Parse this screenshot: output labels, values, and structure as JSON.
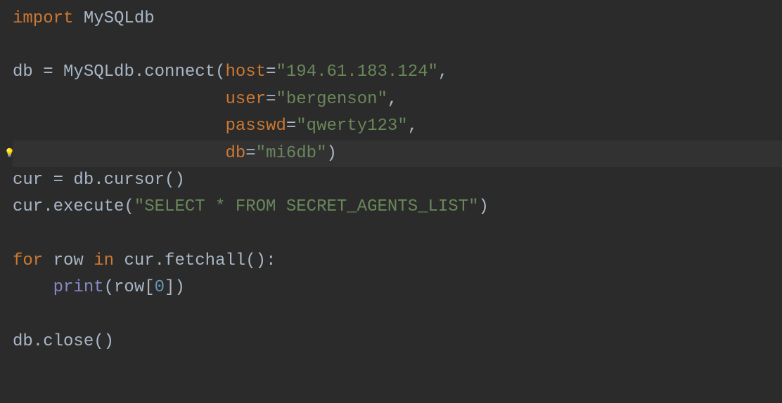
{
  "code": {
    "line1": {
      "import_kw": "import",
      "module": " MySQLdb"
    },
    "line2": {
      "text": ""
    },
    "line3": {
      "var": "db ",
      "eq": "= ",
      "call": "MySQLdb.connect(",
      "param1": "host",
      "eq1": "=",
      "str1": "\"194.61.183.124\"",
      "comma1": ","
    },
    "line4": {
      "indent": "                     ",
      "param": "user",
      "eq": "=",
      "str": "\"bergenson\"",
      "comma": ","
    },
    "line5": {
      "indent": "                     ",
      "param": "passwd",
      "eq": "=",
      "str": "\"qwerty123\"",
      "comma": ","
    },
    "line6": {
      "indent": "                     ",
      "param": "db",
      "eq": "=",
      "str": "\"mi6db\"",
      "paren": ")"
    },
    "line7": {
      "var": "cur ",
      "eq": "= ",
      "call": "db.cursor()"
    },
    "line8": {
      "obj": "cur.execute(",
      "str": "\"SELECT * FROM SECRET_AGENTS_LIST\"",
      "paren": ")"
    },
    "line9": {
      "text": ""
    },
    "line10": {
      "for_kw": "for",
      "mid": " row ",
      "in_kw": "in",
      "call": " cur.fetchall():"
    },
    "line11": {
      "indent": "    ",
      "builtin": "print",
      "open": "(row[",
      "num": "0",
      "close": "])"
    },
    "line12": {
      "text": ""
    },
    "line13": {
      "call": "db.close()"
    }
  },
  "icon": {
    "bulb": "💡"
  }
}
